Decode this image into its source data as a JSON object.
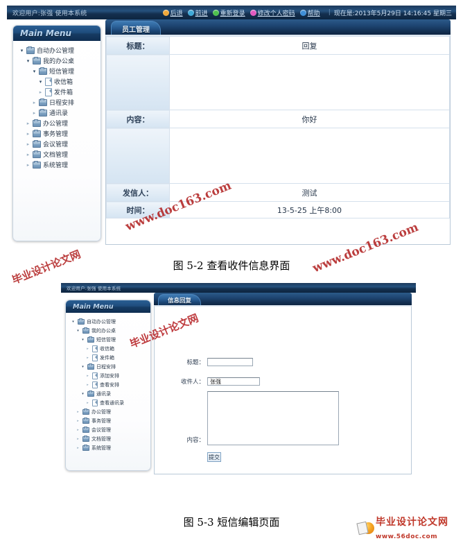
{
  "figure1": {
    "header": {
      "welcome": "欢迎用户:张强 使用本系统",
      "links": [
        {
          "label": "后退",
          "color": "#f0a93c",
          "icon": "back-icon"
        },
        {
          "label": "前进",
          "color": "#3fa9d8",
          "icon": "forward-icon"
        },
        {
          "label": "重新登录",
          "color": "#4fc24f",
          "icon": "relogin-icon"
        },
        {
          "label": "修改个人密码",
          "color": "#e05ac0",
          "icon": "password-icon"
        },
        {
          "label": "帮助",
          "color": "#3f8fd8",
          "icon": "help-icon"
        }
      ],
      "time_text": "现在是:2013年5月29日 14:16:45 星期三"
    },
    "sidebar": {
      "title": "Main Menu",
      "items": [
        {
          "label": "自动办公管理",
          "type": "folder",
          "depth": 0,
          "state": "open"
        },
        {
          "label": "我的办公桌",
          "type": "folder",
          "depth": 1,
          "state": "open"
        },
        {
          "label": "短信管理",
          "type": "folder",
          "depth": 2,
          "state": "open"
        },
        {
          "label": "收信箱",
          "type": "doc",
          "depth": 3,
          "state": "open"
        },
        {
          "label": "发件箱",
          "type": "doc",
          "depth": 3,
          "state": "closed"
        },
        {
          "label": "日程安排",
          "type": "folder",
          "depth": 2,
          "state": "closed"
        },
        {
          "label": "通讯录",
          "type": "folder",
          "depth": 2,
          "state": "closed"
        },
        {
          "label": "办公管理",
          "type": "folder",
          "depth": 1,
          "state": "closed"
        },
        {
          "label": "事务管理",
          "type": "folder",
          "depth": 1,
          "state": "closed"
        },
        {
          "label": "会议管理",
          "type": "folder",
          "depth": 1,
          "state": "closed"
        },
        {
          "label": "文档管理",
          "type": "folder",
          "depth": 1,
          "state": "closed"
        },
        {
          "label": "系统管理",
          "type": "folder",
          "depth": 1,
          "state": "closed"
        }
      ]
    },
    "tab": "员工管理",
    "detail_rows": [
      {
        "label": "标题：",
        "value": "回复"
      },
      {
        "label": "",
        "value": ""
      },
      {
        "label": "内容：",
        "value": "你好"
      },
      {
        "label": "",
        "value": ""
      },
      {
        "label": "发信人：",
        "value": "测试"
      },
      {
        "label": "时间：",
        "value": "13-5-25 上午8:00"
      }
    ],
    "watermark": "www.doc163.com"
  },
  "caption1": "图 5-2  查看收件信息界面",
  "figure2": {
    "header": {
      "welcome": "欢迎用户:张强 使用本系统"
    },
    "sidebar": {
      "title": "Main Menu",
      "items": [
        {
          "label": "自动办公管理",
          "type": "folder",
          "depth": 0,
          "state": "open"
        },
        {
          "label": "我的办公桌",
          "type": "folder",
          "depth": 1,
          "state": "open"
        },
        {
          "label": "短信管理",
          "type": "folder",
          "depth": 2,
          "state": "open"
        },
        {
          "label": "收信箱",
          "type": "doc",
          "depth": 3,
          "state": "closed"
        },
        {
          "label": "发件箱",
          "type": "doc",
          "depth": 3,
          "state": "closed"
        },
        {
          "label": "日程安排",
          "type": "folder",
          "depth": 2,
          "state": "open"
        },
        {
          "label": "添加安排",
          "type": "doc",
          "depth": 3,
          "state": "closed"
        },
        {
          "label": "查看安排",
          "type": "doc",
          "depth": 3,
          "state": "closed"
        },
        {
          "label": "通讯录",
          "type": "folder",
          "depth": 2,
          "state": "open"
        },
        {
          "label": "查看通讯录",
          "type": "doc",
          "depth": 3,
          "state": "closed"
        },
        {
          "label": "办公管理",
          "type": "folder",
          "depth": 1,
          "state": "closed"
        },
        {
          "label": "事务管理",
          "type": "folder",
          "depth": 1,
          "state": "closed"
        },
        {
          "label": "会议管理",
          "type": "folder",
          "depth": 1,
          "state": "closed"
        },
        {
          "label": "文档管理",
          "type": "folder",
          "depth": 1,
          "state": "closed"
        },
        {
          "label": "系统管理",
          "type": "folder",
          "depth": 1,
          "state": "closed"
        }
      ]
    },
    "tab": "信息回复",
    "form": {
      "title_label": "标题：",
      "title_value": "",
      "title_placeholder": "",
      "recipient_label": "收件人：",
      "recipient_value": "张强",
      "content_label": "内容：",
      "content_value": "",
      "submit_label": "提交"
    },
    "watermark1": "毕业设计论文网",
    "watermark2": "www.doc163.com"
  },
  "caption2": "图 5-3  短信编辑页面",
  "logo": {
    "line1": "毕业设计论文网",
    "line2": "www.56doc.com"
  }
}
